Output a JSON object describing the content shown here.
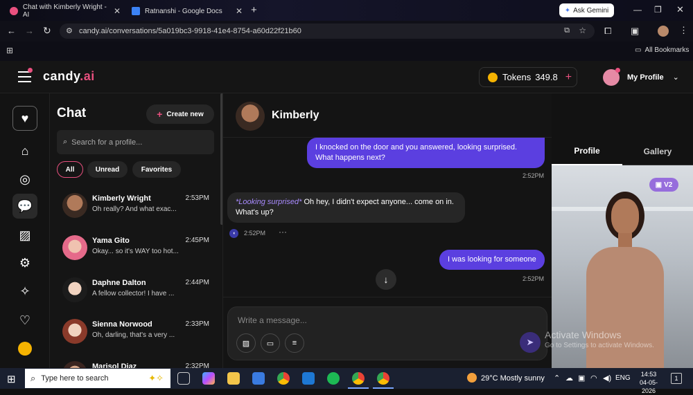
{
  "browser": {
    "tabs": [
      {
        "title": "Chat with Kimberly Wright - AI"
      },
      {
        "title": "Ratnanshi - Google Docs"
      }
    ],
    "ask_gemini": "Ask Gemini",
    "url": "candy.ai/conversations/5a019bc3-9918-41e4-8754-a60d22f21b60",
    "all_bookmarks": "All Bookmarks"
  },
  "app": {
    "logo_main": "candy",
    "logo_ai": ".ai",
    "tokens_label": "Tokens",
    "tokens_value": "349.8",
    "profile_label": "My Profile"
  },
  "chatlist": {
    "title": "Chat",
    "create_new": "Create new",
    "search_placeholder": "Search for a profile...",
    "filters": [
      "All",
      "Unread",
      "Favorites"
    ],
    "items": [
      {
        "name": "Kimberly Wright",
        "time": "2:53PM",
        "preview": "Oh really? And what exac..."
      },
      {
        "name": "Yama Gito",
        "time": "2:45PM",
        "preview": "Okay... so it's WAY too hot..."
      },
      {
        "name": "Daphne Dalton",
        "time": "2:44PM",
        "preview": "A fellow collector! I have ..."
      },
      {
        "name": "Sienna Norwood",
        "time": "2:33PM",
        "preview": "Oh, darling, that's a very ..."
      },
      {
        "name": "Marisol Diaz",
        "time": "2:32PM",
        "preview": ""
      }
    ]
  },
  "conversation": {
    "name": "Kimberly",
    "messages": [
      {
        "role": "user",
        "text": "I knocked on the door and you answered, looking surprised. What happens next?",
        "time": "2:52PM"
      },
      {
        "role": "ai",
        "action": "*Looking surprised*",
        "text": " Oh hey, I didn't expect anyone... come on in. What's up?",
        "time": "2:52PM"
      },
      {
        "role": "user",
        "text": "I was looking for someone",
        "time": "2:52PM"
      }
    ],
    "input_placeholder": "Write a message..."
  },
  "rightpanel": {
    "tabs": [
      "Profile",
      "Gallery"
    ],
    "badge": "V2"
  },
  "watermark": {
    "line1": "Activate Windows",
    "line2": "Go to Settings to activate Windows."
  },
  "taskbar": {
    "search_placeholder": "Type here to search",
    "weather": "29°C  Mostly sunny",
    "lang": "ENG",
    "time": "14:53",
    "date": "04-05-2026",
    "notif_count": "1"
  },
  "colors": {
    "accent": "#e9507f",
    "user_bubble": "#5b3fe0",
    "token_coin": "#f5b301"
  }
}
